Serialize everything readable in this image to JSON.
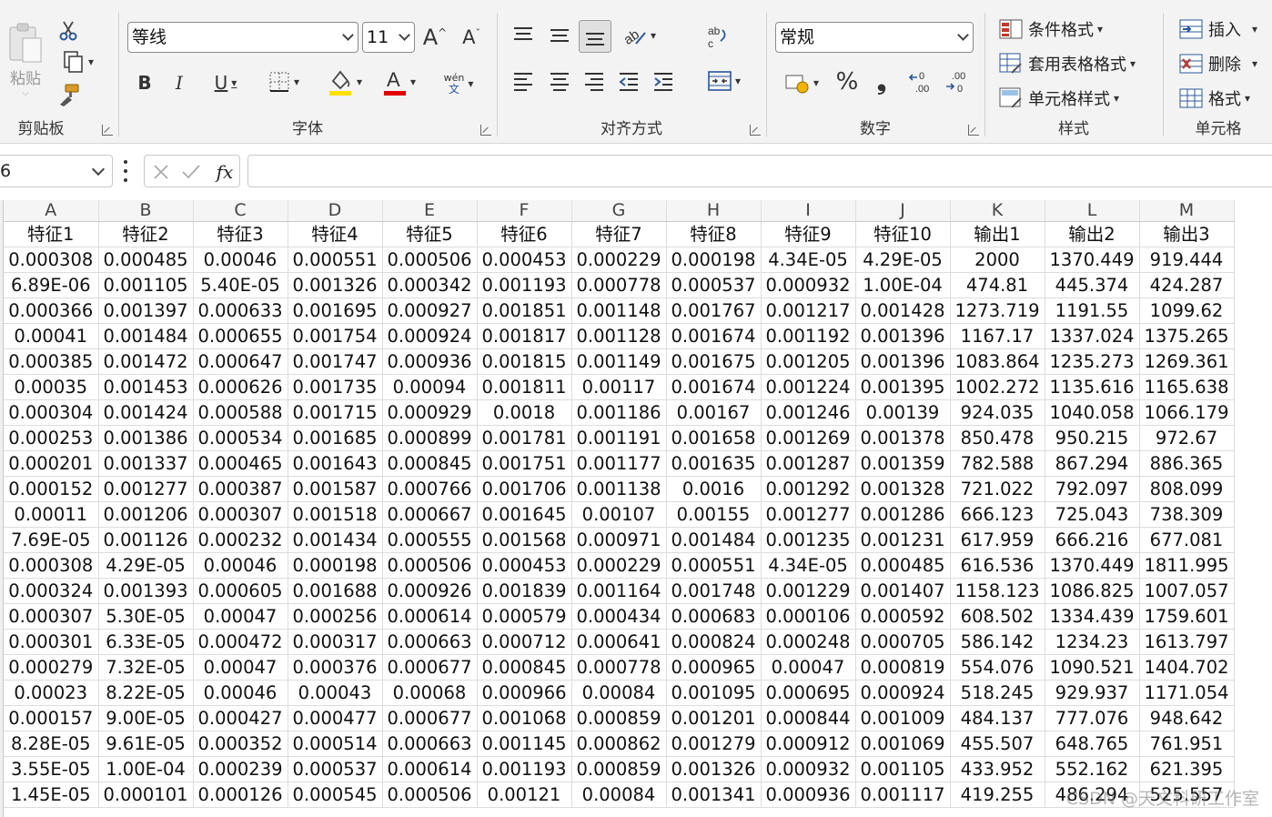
{
  "ribbon": {
    "clipboard": {
      "paste_label": "粘贴",
      "group_label": "剪贴板"
    },
    "font": {
      "font_name": "等线",
      "font_size": "11",
      "bold": "B",
      "italic": "I",
      "underline": "U",
      "wen_top": "wén",
      "wen_bottom": "文",
      "group_label": "字体",
      "fill_color": "#ffe100",
      "font_color": "#e00000"
    },
    "alignment": {
      "group_label": "对齐方式"
    },
    "number": {
      "format": "常规",
      "percent": "%",
      "comma": "❟",
      "dec_inc": ".00",
      "dec_dec": ".00",
      "group_label": "数字"
    },
    "styles": {
      "conditional": "条件格式",
      "table_format": "套用表格格式",
      "cell_styles": "单元格样式",
      "group_label": "样式"
    },
    "cells": {
      "insert": "插入",
      "delete": "删除",
      "format": "格式",
      "group_label": "单元格"
    }
  },
  "formula_bar": {
    "name_box": "6",
    "fx": "fx",
    "value": ""
  },
  "grid": {
    "columns": [
      "A",
      "B",
      "C",
      "D",
      "E",
      "F",
      "G",
      "H",
      "I",
      "J",
      "K",
      "L",
      "M"
    ],
    "rows": [
      [
        "特征1",
        "特征2",
        "特征3",
        "特征4",
        "特征5",
        "特征6",
        "特征7",
        "特征8",
        "特征9",
        "特征10",
        "输出1",
        "输出2",
        "输出3"
      ],
      [
        "0.000308",
        "0.000485",
        "0.00046",
        "0.000551",
        "0.000506",
        "0.000453",
        "0.000229",
        "0.000198",
        "4.34E-05",
        "4.29E-05",
        "2000",
        "1370.449",
        "919.444"
      ],
      [
        "6.89E-06",
        "0.001105",
        "5.40E-05",
        "0.001326",
        "0.000342",
        "0.001193",
        "0.000778",
        "0.000537",
        "0.000932",
        "1.00E-04",
        "474.81",
        "445.374",
        "424.287"
      ],
      [
        "0.000366",
        "0.001397",
        "0.000633",
        "0.001695",
        "0.000927",
        "0.001851",
        "0.001148",
        "0.001767",
        "0.001217",
        "0.001428",
        "1273.719",
        "1191.55",
        "1099.62"
      ],
      [
        "0.00041",
        "0.001484",
        "0.000655",
        "0.001754",
        "0.000924",
        "0.001817",
        "0.001128",
        "0.001674",
        "0.001192",
        "0.001396",
        "1167.17",
        "1337.024",
        "1375.265"
      ],
      [
        "0.000385",
        "0.001472",
        "0.000647",
        "0.001747",
        "0.000936",
        "0.001815",
        "0.001149",
        "0.001675",
        "0.001205",
        "0.001396",
        "1083.864",
        "1235.273",
        "1269.361"
      ],
      [
        "0.00035",
        "0.001453",
        "0.000626",
        "0.001735",
        "0.00094",
        "0.001811",
        "0.00117",
        "0.001674",
        "0.001224",
        "0.001395",
        "1002.272",
        "1135.616",
        "1165.638"
      ],
      [
        "0.000304",
        "0.001424",
        "0.000588",
        "0.001715",
        "0.000929",
        "0.0018",
        "0.001186",
        "0.00167",
        "0.001246",
        "0.00139",
        "924.035",
        "1040.058",
        "1066.179"
      ],
      [
        "0.000253",
        "0.001386",
        "0.000534",
        "0.001685",
        "0.000899",
        "0.001781",
        "0.001191",
        "0.001658",
        "0.001269",
        "0.001378",
        "850.478",
        "950.215",
        "972.67"
      ],
      [
        "0.000201",
        "0.001337",
        "0.000465",
        "0.001643",
        "0.000845",
        "0.001751",
        "0.001177",
        "0.001635",
        "0.001287",
        "0.001359",
        "782.588",
        "867.294",
        "886.365"
      ],
      [
        "0.000152",
        "0.001277",
        "0.000387",
        "0.001587",
        "0.000766",
        "0.001706",
        "0.001138",
        "0.0016",
        "0.001292",
        "0.001328",
        "721.022",
        "792.097",
        "808.099"
      ],
      [
        "0.00011",
        "0.001206",
        "0.000307",
        "0.001518",
        "0.000667",
        "0.001645",
        "0.00107",
        "0.00155",
        "0.001277",
        "0.001286",
        "666.123",
        "725.043",
        "738.309"
      ],
      [
        "7.69E-05",
        "0.001126",
        "0.000232",
        "0.001434",
        "0.000555",
        "0.001568",
        "0.000971",
        "0.001484",
        "0.001235",
        "0.001231",
        "617.959",
        "666.216",
        "677.081"
      ],
      [
        "0.000308",
        "4.29E-05",
        "0.00046",
        "0.000198",
        "0.000506",
        "0.000453",
        "0.000229",
        "0.000551",
        "4.34E-05",
        "0.000485",
        "616.536",
        "1370.449",
        "1811.995"
      ],
      [
        "0.000324",
        "0.001393",
        "0.000605",
        "0.001688",
        "0.000926",
        "0.001839",
        "0.001164",
        "0.001748",
        "0.001229",
        "0.001407",
        "1158.123",
        "1086.825",
        "1007.057"
      ],
      [
        "0.000307",
        "5.30E-05",
        "0.00047",
        "0.000256",
        "0.000614",
        "0.000579",
        "0.000434",
        "0.000683",
        "0.000106",
        "0.000592",
        "608.502",
        "1334.439",
        "1759.601"
      ],
      [
        "0.000301",
        "6.33E-05",
        "0.000472",
        "0.000317",
        "0.000663",
        "0.000712",
        "0.000641",
        "0.000824",
        "0.000248",
        "0.000705",
        "586.142",
        "1234.23",
        "1613.797"
      ],
      [
        "0.000279",
        "7.32E-05",
        "0.00047",
        "0.000376",
        "0.000677",
        "0.000845",
        "0.000778",
        "0.000965",
        "0.00047",
        "0.000819",
        "554.076",
        "1090.521",
        "1404.702"
      ],
      [
        "0.00023",
        "8.22E-05",
        "0.00046",
        "0.00043",
        "0.00068",
        "0.000966",
        "0.00084",
        "0.001095",
        "0.000695",
        "0.000924",
        "518.245",
        "929.937",
        "1171.054"
      ],
      [
        "0.000157",
        "9.00E-05",
        "0.000427",
        "0.000477",
        "0.000677",
        "0.001068",
        "0.000859",
        "0.001201",
        "0.000844",
        "0.001009",
        "484.137",
        "777.076",
        "948.642"
      ],
      [
        "8.28E-05",
        "9.61E-05",
        "0.000352",
        "0.000514",
        "0.000663",
        "0.001145",
        "0.000862",
        "0.001279",
        "0.000912",
        "0.001069",
        "455.507",
        "648.765",
        "761.951"
      ],
      [
        "3.55E-05",
        "1.00E-04",
        "0.000239",
        "0.000537",
        "0.000614",
        "0.001193",
        "0.000859",
        "0.001326",
        "0.000932",
        "0.001105",
        "433.952",
        "552.162",
        "621.395"
      ],
      [
        "1.45E-05",
        "0.000101",
        "0.000126",
        "0.000545",
        "0.000506",
        "0.00121",
        "0.00084",
        "0.001341",
        "0.000936",
        "0.001117",
        "419.255",
        "486.294",
        "525.557"
      ]
    ]
  },
  "watermark": "CSDN @天文科研工作室"
}
